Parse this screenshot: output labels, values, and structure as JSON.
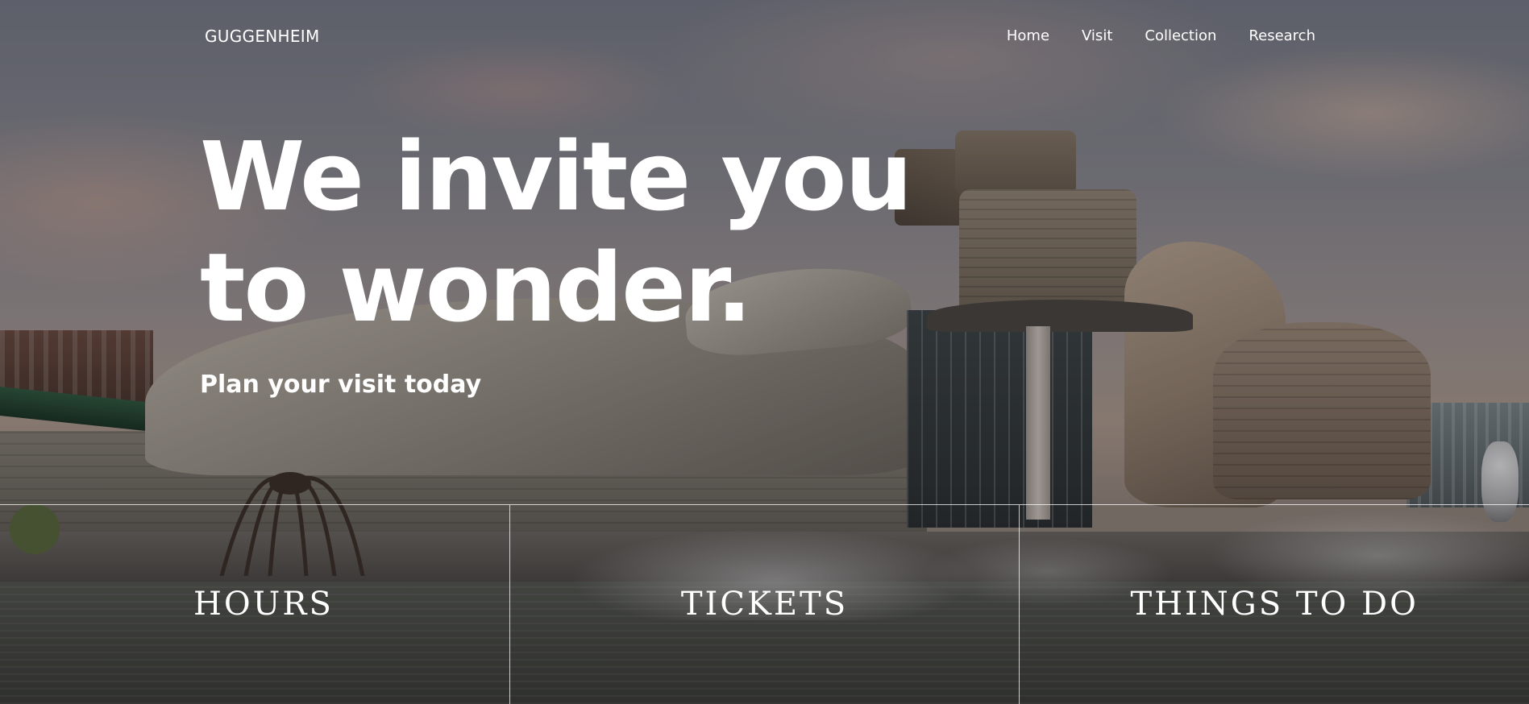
{
  "header": {
    "logo": "GUGGENHEIM",
    "nav": [
      {
        "label": "Home"
      },
      {
        "label": "Visit"
      },
      {
        "label": "Collection"
      },
      {
        "label": "Research"
      }
    ]
  },
  "hero": {
    "title_line1": "We invite you",
    "title_line2": "to wonder.",
    "subtitle": "Plan your visit today"
  },
  "links": [
    {
      "label": "HOURS"
    },
    {
      "label": "TICKETS"
    },
    {
      "label": "THINGS TO DO"
    }
  ],
  "colors": {
    "text": "#ffffff",
    "overlay": "#18181e"
  }
}
